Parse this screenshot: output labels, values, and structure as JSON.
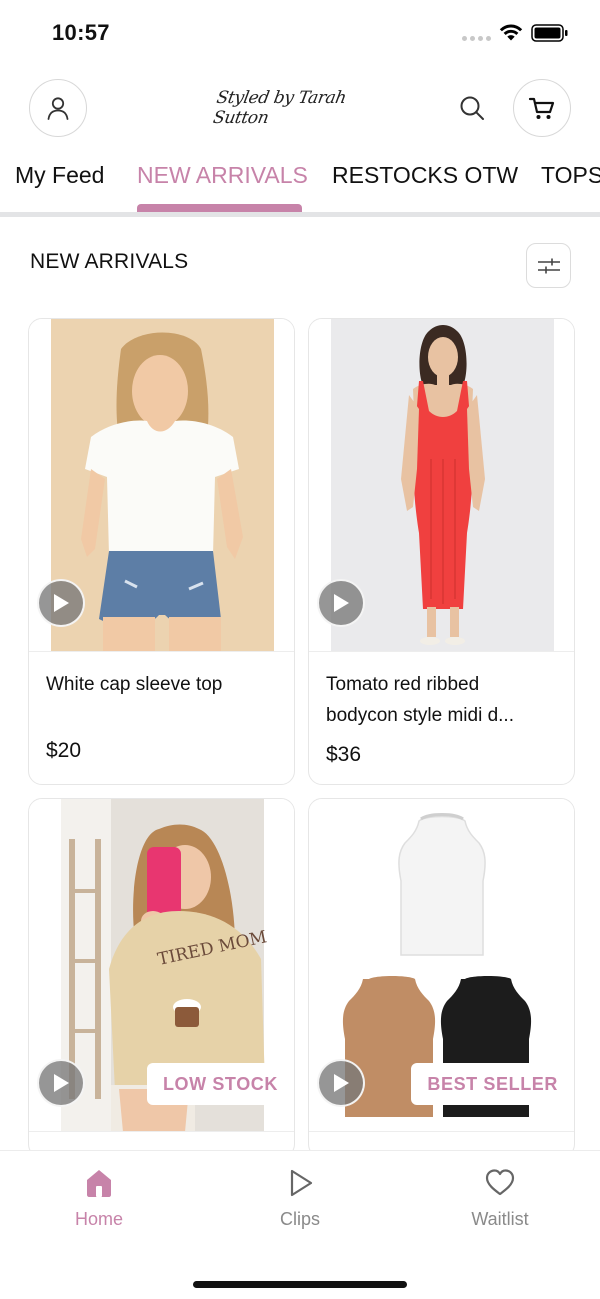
{
  "status_bar": {
    "time": "10:57"
  },
  "header": {
    "brand": "Styled by Tarah Sutton",
    "icons": {
      "account": "user-icon",
      "search": "search-icon",
      "cart": "cart-icon"
    }
  },
  "tabs": [
    {
      "label": "My Feed",
      "active": false
    },
    {
      "label": "NEW ARRIVALS",
      "active": true
    },
    {
      "label": "RESTOCKS OTW",
      "active": false
    },
    {
      "label": "TOPS",
      "active": false
    }
  ],
  "section": {
    "title": "NEW ARRIVALS",
    "filter_icon": "sliders-icon"
  },
  "products": [
    {
      "name": "White cap sleeve top",
      "price": "$20",
      "badge": ""
    },
    {
      "name": "Tomato red ribbed bodycon style midi d...",
      "price": "$36",
      "badge": ""
    },
    {
      "name": "",
      "price": "",
      "badge": "LOW STOCK"
    },
    {
      "name": "",
      "price": "",
      "badge": "BEST SELLER"
    }
  ],
  "bottom_nav": [
    {
      "label": "Home",
      "icon": "home-icon",
      "active": true
    },
    {
      "label": "Clips",
      "icon": "play-icon",
      "active": false
    },
    {
      "label": "Waitlist",
      "icon": "heart-icon",
      "active": false
    }
  ],
  "colors": {
    "accent": "#c783a9",
    "tab_line": "#e3e4e6"
  }
}
